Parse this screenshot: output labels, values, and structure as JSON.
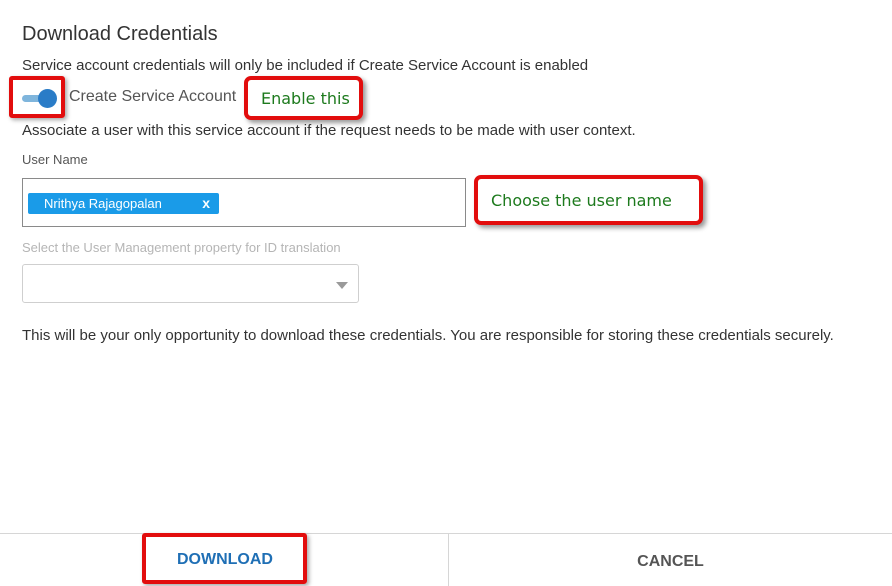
{
  "dialog": {
    "title": "Download Credentials",
    "description": "Service account credentials will only be included if Create Service Account is enabled"
  },
  "toggle": {
    "label": "Create Service Account",
    "enabled": true
  },
  "annotations": {
    "enable": "Enable this",
    "user": "Choose the user name"
  },
  "association_text": "Associate a user with this service account if the request needs to be made with user context.",
  "user_field": {
    "label": "User Name",
    "selected_user": "Nrithya Rajagopalan",
    "remove_symbol": "x"
  },
  "property_field": {
    "label": "Select the User Management property for ID translation",
    "value": ""
  },
  "notice": "This will be your only opportunity to download these credentials. You are responsible for storing these credentials securely.",
  "footer": {
    "download_label": "DOWNLOAD",
    "cancel_label": "CANCEL"
  },
  "colors": {
    "accent": "#2a7cc7",
    "chip": "#1a9be8",
    "highlight": "#e20d0d",
    "annotation_text": "#1d7a1d"
  }
}
